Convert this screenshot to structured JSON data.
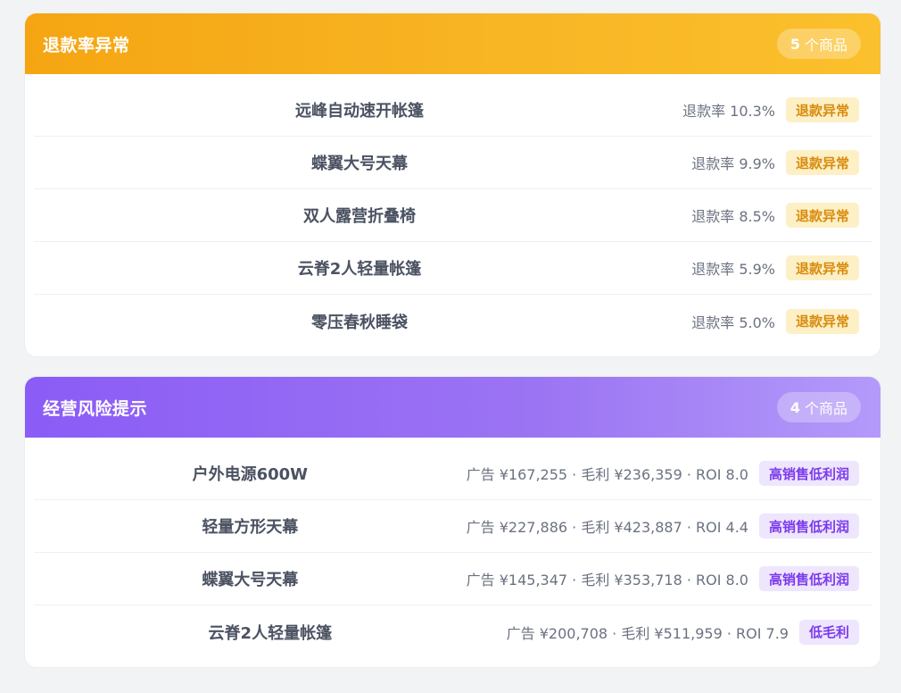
{
  "refund_card": {
    "title": "退款率异常",
    "count_num": "5",
    "count_unit": "个商品",
    "items": [
      {
        "name": "远峰自动速开帐篷",
        "meta": "退款率 10.3%",
        "tag": "退款异常"
      },
      {
        "name": "蝶翼大号天幕",
        "meta": "退款率 9.9%",
        "tag": "退款异常"
      },
      {
        "name": "双人露营折叠椅",
        "meta": "退款率 8.5%",
        "tag": "退款异常"
      },
      {
        "name": "云脊2人轻量帐篷",
        "meta": "退款率 5.9%",
        "tag": "退款异常"
      },
      {
        "name": "零压春秋睡袋",
        "meta": "退款率 5.0%",
        "tag": "退款异常"
      }
    ]
  },
  "risk_card": {
    "title": "经营风险提示",
    "count_num": "4",
    "count_unit": "个商品",
    "items": [
      {
        "name": "户外电源600W",
        "meta": "广告 ¥167,255 · 毛利 ¥236,359 · ROI 8.0",
        "tag": "高销售低利润"
      },
      {
        "name": "轻量方形天幕",
        "meta": "广告 ¥227,886 · 毛利 ¥423,887 · ROI 4.4",
        "tag": "高销售低利润"
      },
      {
        "name": "蝶翼大号天幕",
        "meta": "广告 ¥145,347 · 毛利 ¥353,718 · ROI 8.0",
        "tag": "高销售低利润"
      },
      {
        "name": "云脊2人轻量帐篷",
        "meta": "广告 ¥200,708 · 毛利 ¥511,959 · ROI 7.9",
        "tag": "低毛利"
      }
    ]
  },
  "colors": {
    "refund_accent": "#f5a512",
    "risk_accent": "#8b5cf6"
  }
}
